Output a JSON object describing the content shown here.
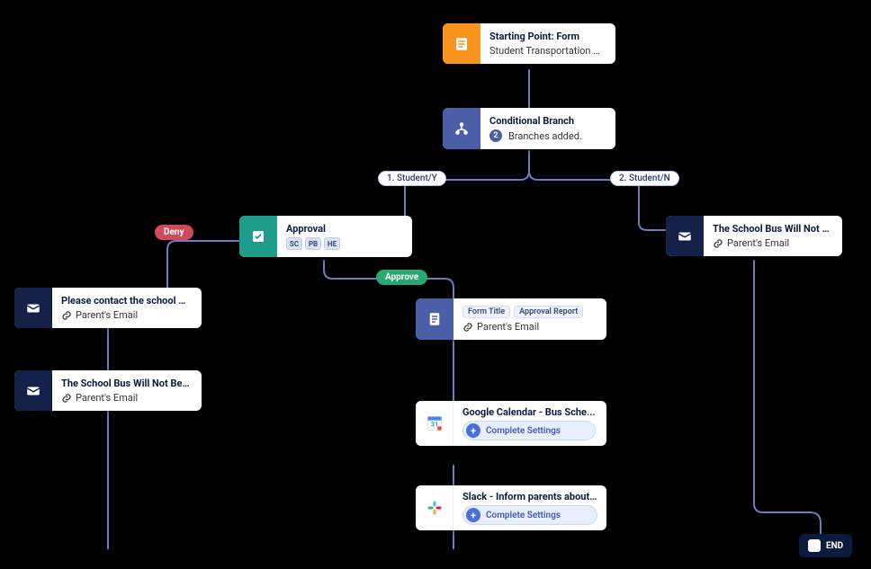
{
  "nodes": {
    "start": {
      "title": "Starting Point: Form",
      "subtitle": "Student Transportation Form"
    },
    "cond": {
      "title": "Conditional Branch",
      "count": "2",
      "count_text": "Branches added."
    },
    "branch1": {
      "label": "1. Student/Y"
    },
    "branch2": {
      "label": "2. Student/N"
    },
    "approval": {
      "title": "Approval",
      "avatars": [
        "SC",
        "PB",
        "HE"
      ]
    },
    "deny": {
      "label": "Deny"
    },
    "approve": {
      "label": "Approve"
    },
    "denyMail": {
      "title": "Please contact the school ma...",
      "link": "Parent's Email"
    },
    "denyMail2": {
      "title": "The School Bus Will Not Be U...",
      "link": "Parent's Email"
    },
    "noMail": {
      "title": "The School Bus Will Not Be U...",
      "link": "Parent's Email"
    },
    "report": {
      "chip1": "Form Title",
      "chip2": "Approval Report",
      "link": "Parent's Email"
    },
    "gcal": {
      "title": "Google Calendar - Bus Sche...",
      "settings": "Complete Settings"
    },
    "slack": {
      "title": "Slack - Inform parents about ...",
      "settings": "Complete Settings"
    },
    "end": {
      "label": "END"
    }
  }
}
